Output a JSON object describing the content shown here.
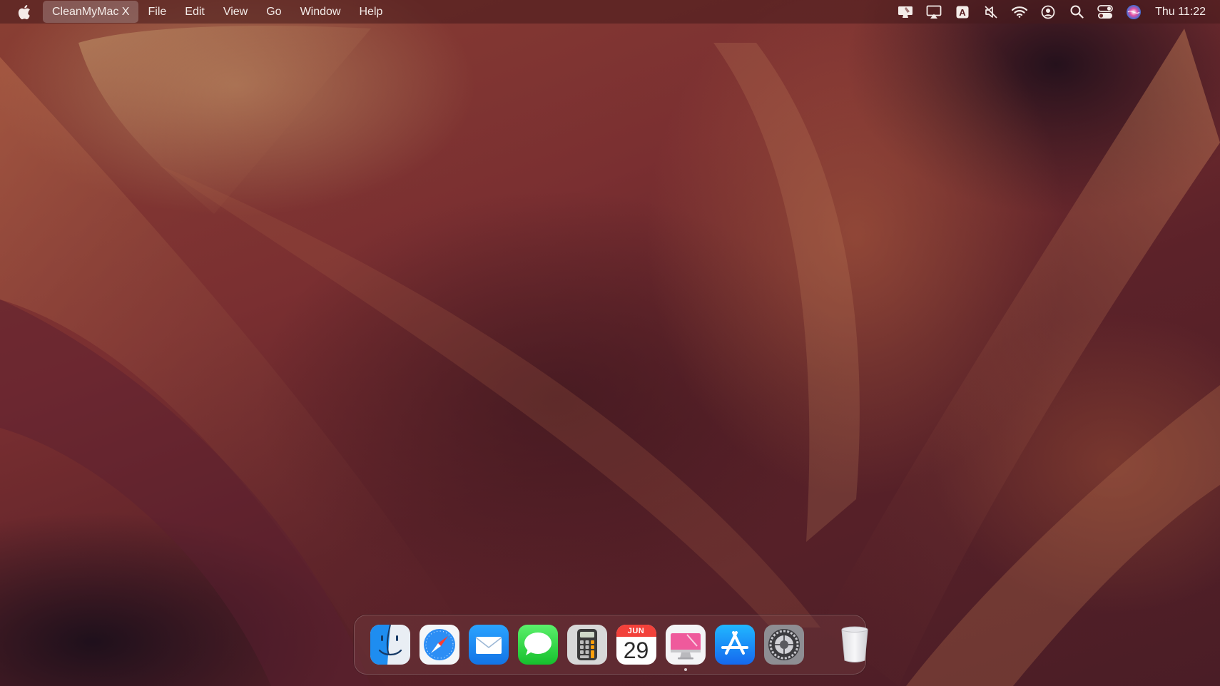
{
  "menubar": {
    "apple_icon": "apple-logo-icon",
    "app_name": "CleanMyMac X",
    "menus": [
      "File",
      "Edit",
      "View",
      "Go",
      "Window",
      "Help"
    ],
    "status_icons": [
      "cleanmymac-menu-icon",
      "airplay-icon",
      "input-source-icon",
      "sound-muted-icon",
      "wifi-icon",
      "user-account-icon",
      "spotlight-search-icon",
      "control-center-icon",
      "siri-icon"
    ],
    "input_source_letter": "A",
    "clock": "Thu 11:22"
  },
  "dock": {
    "apps": [
      {
        "name": "Finder",
        "icon": "finder-icon",
        "running": false
      },
      {
        "name": "Safari",
        "icon": "safari-icon",
        "running": false
      },
      {
        "name": "Mail",
        "icon": "mail-icon",
        "running": false
      },
      {
        "name": "Messages",
        "icon": "messages-icon",
        "running": false
      },
      {
        "name": "Calculator",
        "icon": "calculator-icon",
        "running": false
      },
      {
        "name": "Calendar",
        "icon": "calendar-icon",
        "running": false
      },
      {
        "name": "CleanMyMac X",
        "icon": "cleanmymac-icon",
        "running": true
      },
      {
        "name": "App Store",
        "icon": "app-store-icon",
        "running": false
      },
      {
        "name": "System Preferences",
        "icon": "system-preferences-icon",
        "running": false
      }
    ],
    "calendar_month": "JUN",
    "calendar_day": "29",
    "trash": {
      "name": "Trash",
      "icon": "trash-icon"
    }
  }
}
